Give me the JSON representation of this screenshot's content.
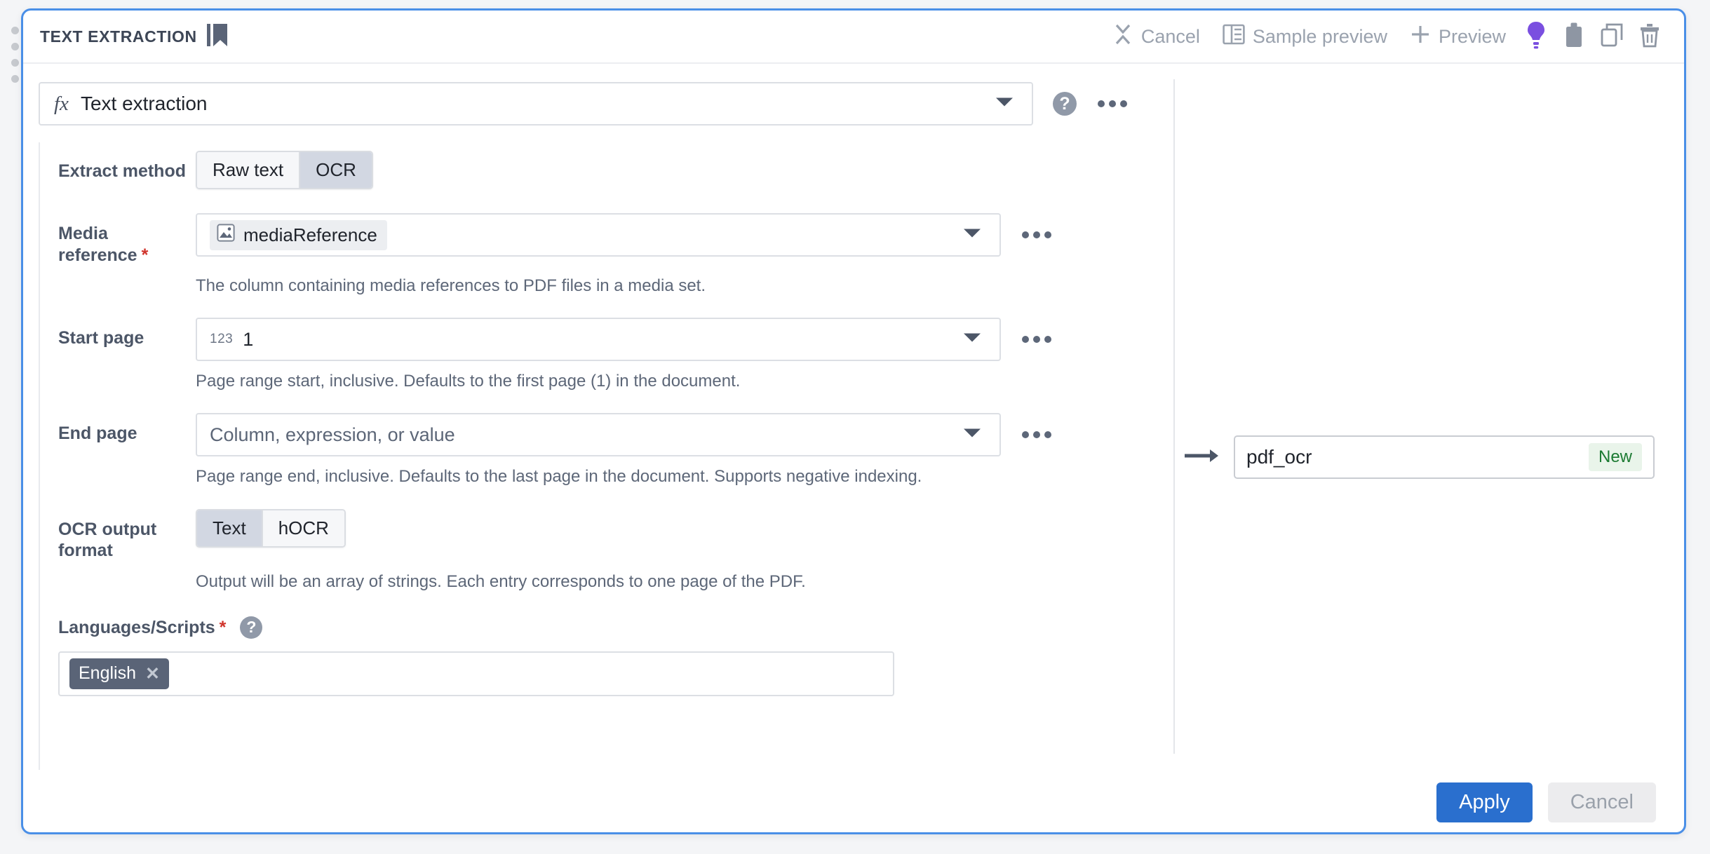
{
  "header": {
    "title": "TEXT EXTRACTION",
    "bookmark_icon": "bookmark-icon",
    "actions": [
      {
        "label": "Cancel",
        "icon": "collapse-x-icon"
      },
      {
        "label": "Sample preview",
        "icon": "sample-panel-icon"
      },
      {
        "label": "Preview",
        "icon": "plus-icon"
      }
    ],
    "icon_buttons": [
      {
        "name": "lightbulb-icon",
        "color": "#7a4fe0"
      },
      {
        "name": "clipboard-icon",
        "color": "#8e96a3"
      },
      {
        "name": "duplicate-icon",
        "color": "#8e96a3"
      },
      {
        "name": "trash-icon",
        "color": "#8e96a3"
      }
    ]
  },
  "function": {
    "fx_symbol": "fx",
    "label": "Text extraction",
    "help_label": "?",
    "menu_label": "more-options"
  },
  "fields": {
    "extract_method": {
      "label": "Extract method",
      "options": [
        "Raw text",
        "OCR"
      ],
      "selected": "OCR"
    },
    "media_reference": {
      "label": "Media reference",
      "required": "*",
      "value": "mediaReference",
      "value_icon": "image-icon",
      "hint": "The column containing media references to PDF files in a media set."
    },
    "start_page": {
      "label": "Start page",
      "type_badge": "123",
      "value": "1",
      "hint": "Page range start, inclusive. Defaults to the first page (1) in the document."
    },
    "end_page": {
      "label": "End page",
      "placeholder": "Column, expression, or value",
      "hint": "Page range end, inclusive. Defaults to the last page in the document. Supports negative indexing."
    },
    "ocr_output_format": {
      "label": "OCR output format",
      "options": [
        "Text",
        "hOCR"
      ],
      "selected": "Text",
      "hint": "Output will be an array of strings. Each entry corresponds to one page of the PDF."
    },
    "languages_scripts": {
      "label": "Languages/Scripts",
      "required": "*",
      "help_label": "?",
      "tags": [
        {
          "label": "English",
          "remove": "✕"
        }
      ]
    }
  },
  "output": {
    "arrow": "arrow-right-icon",
    "name": "pdf_ocr",
    "badge": "New"
  },
  "footer": {
    "apply_label": "Apply",
    "cancel_label": "Cancel"
  },
  "colors": {
    "accent_border": "#4a8fe7",
    "primary_button": "#2a6fce",
    "required_star": "#d0342c",
    "new_badge_text": "#1b7a32",
    "lightbulb": "#7a4fe0"
  }
}
